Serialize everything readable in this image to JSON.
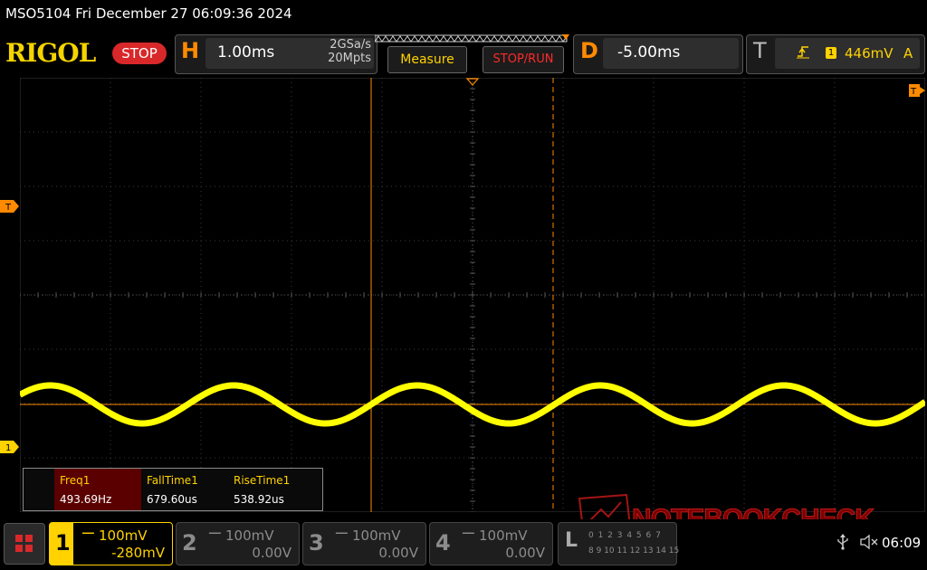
{
  "titlebar": {
    "text": "MSO5104  Fri December 27 06:09:36 2024"
  },
  "toolbar": {
    "logo": "RIGOL",
    "status": "STOP",
    "horizontal": {
      "letter": "H",
      "timebase": "1.00ms",
      "sample_rate": "2GSa/s",
      "memory_depth": "20Mpts"
    },
    "measure_label": "Measure",
    "stoprun_label": "STOP/RUN",
    "delay": {
      "letter": "D",
      "value": "-5.00ms"
    },
    "trigger": {
      "letter": "T",
      "channel": "1",
      "level": "446mV",
      "mode": "A"
    }
  },
  "markers": {
    "trigger_level": "T",
    "channel1_ground": "1",
    "trigger_position": "T"
  },
  "waveform": {
    "channel": 1,
    "frequency_hz": 493.69,
    "color": "#ffff00"
  },
  "measurements": [
    {
      "name": "Freq1",
      "value": "493.69Hz",
      "selected": true
    },
    {
      "name": "FallTime1",
      "value": "679.60us",
      "selected": false
    },
    {
      "name": "RiseTime1",
      "value": "538.92us",
      "selected": false
    }
  ],
  "watermark": "NOTEBOOKCHECK",
  "channels": [
    {
      "number": "1",
      "scale": "100mV",
      "offset": "-280mV",
      "active": true
    },
    {
      "number": "2",
      "scale": "100mV",
      "offset": "0.00V",
      "active": false
    },
    {
      "number": "3",
      "scale": "100mV",
      "offset": "0.00V",
      "active": false
    },
    {
      "number": "4",
      "scale": "100mV",
      "offset": "0.00V",
      "active": false
    }
  ],
  "logic": {
    "letter": "L",
    "row1": "0 1 2 3 4 5 6 7",
    "row2": "8 9 10 11 12 13 14 15"
  },
  "status_bar": {
    "clock": "06:09"
  },
  "colors": {
    "accent_orange": "#ff8a00",
    "channel1": "#ffd200",
    "stop_red": "#d8282a",
    "measure_selected_bg": "#5a0000"
  }
}
